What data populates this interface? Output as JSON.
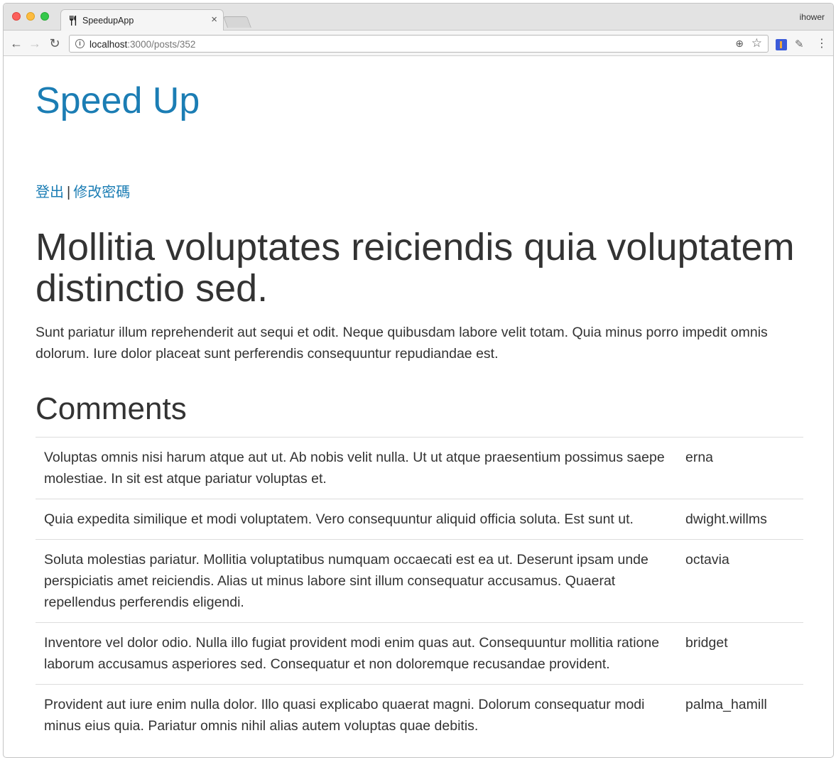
{
  "browser": {
    "tab_title": "SpeedupApp",
    "tab_close": "×",
    "profile_name": "ihower",
    "url_host": "localhost",
    "url_path": ":3000/posts/352"
  },
  "site": {
    "brand": "Speed Up",
    "logout_label": "登出",
    "separator": "|",
    "change_password_label": "修改密碼"
  },
  "post": {
    "title": "Mollitia voluptates reiciendis quia voluptatem distinctio sed.",
    "body": "Sunt pariatur illum reprehenderit aut sequi et odit. Neque quibusdam labore velit totam. Quia minus porro impedit omnis dolorum. Iure dolor placeat sunt perferendis consequuntur repudiandae est."
  },
  "comments": {
    "heading": "Comments",
    "rows": [
      {
        "content": "Voluptas omnis nisi harum atque aut ut. Ab nobis velit nulla. Ut ut atque praesentium possimus saepe molestiae. In sit est atque pariatur voluptas et.",
        "author": "erna"
      },
      {
        "content": "Quia expedita similique et modi voluptatem. Vero consequuntur aliquid officia soluta. Est sunt ut.",
        "author": "dwight.willms"
      },
      {
        "content": "Soluta molestias pariatur. Mollitia voluptatibus numquam occaecati est ea ut. Deserunt ipsam unde perspiciatis amet reiciendis. Alias ut minus labore sint illum consequatur accusamus. Quaerat repellendus perferendis eligendi.",
        "author": "octavia"
      },
      {
        "content": "Inventore vel dolor odio. Nulla illo fugiat provident modi enim quas aut. Consequuntur mollitia ratione laborum accusamus asperiores sed. Consequatur et non doloremque recusandae provident.",
        "author": "bridget"
      },
      {
        "content": "Provident aut iure enim nulla dolor. Illo quasi explicabo quaerat magni. Dolorum consequatur modi minus eius quia. Pariatur omnis nihil alias autem voluptas quae debitis.",
        "author": "palma_hamill"
      }
    ]
  },
  "colors": {
    "link": "#1b7db4",
    "text": "#333333",
    "table_border": "#dddddd"
  },
  "icons": {
    "back": "arrow-left-icon",
    "forward": "arrow-right-icon",
    "reload": "reload-icon",
    "info": "info-icon",
    "zoom": "zoom-icon",
    "bookmark": "star-icon",
    "menu": "kebab-menu-icon"
  }
}
